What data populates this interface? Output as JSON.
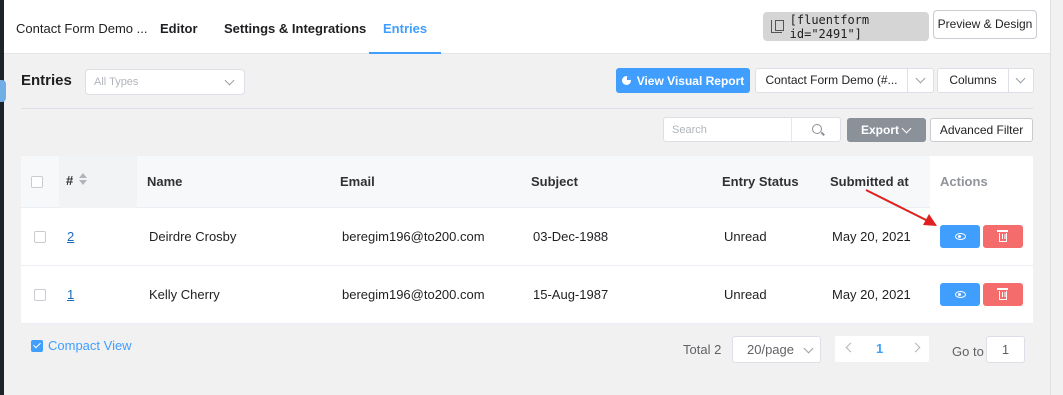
{
  "nav": {
    "form_name": "Contact Form Demo ...",
    "editor": "Editor",
    "settings": "Settings & Integrations",
    "entries": "Entries",
    "shortcode": "[fluentform id=\"2491\"]",
    "preview": "Preview & Design"
  },
  "toolbar": {
    "title": "Entries",
    "type_placeholder": "All Types",
    "visual_report": "View Visual Report",
    "form_select": "Contact Form Demo (#...",
    "columns": "Columns",
    "search_placeholder": "Search",
    "export": "Export",
    "advanced_filter": "Advanced Filter"
  },
  "table": {
    "headers": {
      "id": "#",
      "name": "Name",
      "email": "Email",
      "subject": "Subject",
      "status": "Entry Status",
      "submitted": "Submitted at",
      "actions": "Actions"
    },
    "rows": [
      {
        "id": "2",
        "name": "Deirdre Crosby",
        "email": "beregim196@to200.com",
        "subject": "03-Dec-1988",
        "status": "Unread",
        "submitted": "May 20, 2021"
      },
      {
        "id": "1",
        "name": "Kelly Cherry",
        "email": "beregim196@to200.com",
        "subject": "15-Aug-1987",
        "status": "Unread",
        "submitted": "May 20, 2021"
      }
    ]
  },
  "footer": {
    "compact_view": "Compact View",
    "total": "Total 2",
    "page_size": "20/page",
    "current_page": "1",
    "goto_label": "Go to",
    "goto_value": "1"
  },
  "colors": {
    "primary": "#409eff",
    "danger": "#f56c6c",
    "export_gray": "#8b9199",
    "annotation_arrow": "#e02020"
  }
}
